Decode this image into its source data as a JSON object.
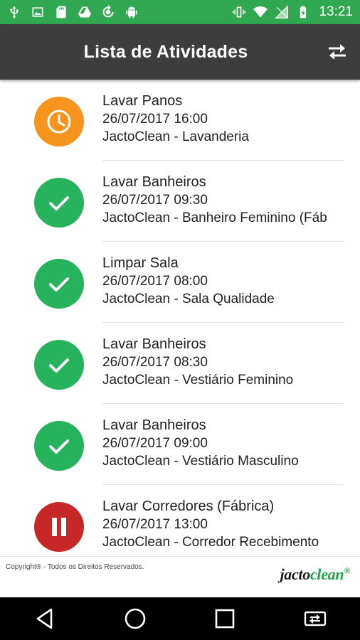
{
  "statusbar": {
    "time": "13:21",
    "left_icons": [
      "usb-icon",
      "image-icon",
      "sd-card-icon",
      "drive-icon",
      "sync-icon",
      "android-icon"
    ],
    "right_icons": [
      "vibrate-icon",
      "wifi-icon",
      "no-signal-icon",
      "battery-icon"
    ]
  },
  "appbar": {
    "title": "Lista de Atividades",
    "action_icon": "swap-icon"
  },
  "activities": [
    {
      "title": "Lavar Panos",
      "datetime": "26/07/2017 16:00",
      "location": "JactoClean - Lavanderia",
      "status": "late",
      "icon": "clock-icon",
      "color": "#f7941d"
    },
    {
      "title": "Lavar Banheiros",
      "datetime": "26/07/2017 09:30",
      "location": "JactoClean - Banheiro Feminino (Fáb",
      "status": "done",
      "icon": "check-icon",
      "color": "#27b35b"
    },
    {
      "title": "Limpar Sala",
      "datetime": "26/07/2017 08:00",
      "location": "JactoClean - Sala Qualidade",
      "status": "done",
      "icon": "check-icon",
      "color": "#27b35b"
    },
    {
      "title": "Lavar Banheiros",
      "datetime": "26/07/2017 08:30",
      "location": "JactoClean - Vestiário Feminino",
      "status": "done",
      "icon": "check-icon",
      "color": "#27b35b"
    },
    {
      "title": "Lavar Banheiros",
      "datetime": "26/07/2017 09:00",
      "location": "JactoClean - Vestiário Masculino",
      "status": "done",
      "icon": "check-icon",
      "color": "#27b35b"
    },
    {
      "title": "Lavar Corredores (Fábrica)",
      "datetime": "26/07/2017 13:00",
      "location": "JactoClean - Corredor Recebimento",
      "status": "paused",
      "icon": "pause-icon",
      "color": "#c62828"
    }
  ],
  "footer": {
    "copyright": "Copyright® - Todos os Direitos Reservados.",
    "brand_part1": "jacto",
    "brand_part2": "clean",
    "brand_mark": "®"
  },
  "navbar": {
    "buttons": [
      "back-icon",
      "home-icon",
      "recents-icon",
      "screen-rotate-icon"
    ]
  },
  "colors": {
    "statusbar": "#2fa84f",
    "appbar": "#3d3d3d",
    "late": "#f7941d",
    "done": "#27b35b",
    "paused": "#c62828"
  }
}
